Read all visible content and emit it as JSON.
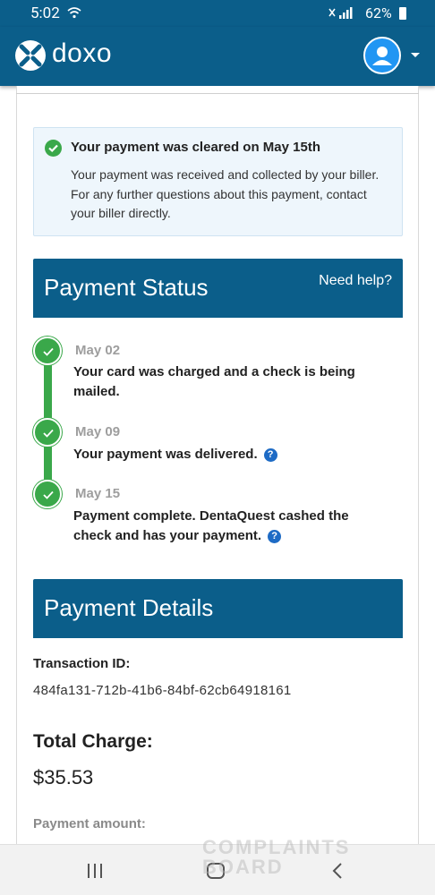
{
  "status_bar": {
    "time": "5:02",
    "battery": "62%"
  },
  "app": {
    "brand": "doxo"
  },
  "notice": {
    "title": "Your payment was cleared on May 15th",
    "body": "Your payment was received and collected by your biller. For any further questions about this payment, contact your biller directly."
  },
  "payment_status": {
    "heading": "Payment Status",
    "help": "Need help?",
    "steps": [
      {
        "date": "May 02",
        "text": "Your card was charged and a check is being mailed."
      },
      {
        "date": "May 09",
        "text": "Your payment was delivered."
      },
      {
        "date": "May 15",
        "text": "Payment complete. DentaQuest cashed the check and has your payment."
      }
    ]
  },
  "payment_details": {
    "heading": "Payment Details",
    "transaction_label": "Transaction ID:",
    "transaction_id": "484fa131-712b-41b6-84bf-62cb64918161",
    "total_label": "Total Charge:",
    "total_value": "$35.53",
    "payment_amount_label": "Payment amount:"
  },
  "watermark": {
    "line1": "COMPLAINTS",
    "line2": "BOARD"
  },
  "colors": {
    "brand_blue": "#0b5e8a",
    "success_green": "#3aa84a",
    "help_blue": "#1e6bc5"
  },
  "icons": [
    "wifi-icon",
    "signal-icon",
    "battery-icon",
    "doxo-logo-icon",
    "user-avatar-icon",
    "chevron-down-icon",
    "check-circle-icon",
    "help-icon",
    "recent-apps-icon",
    "home-icon",
    "back-icon"
  ]
}
